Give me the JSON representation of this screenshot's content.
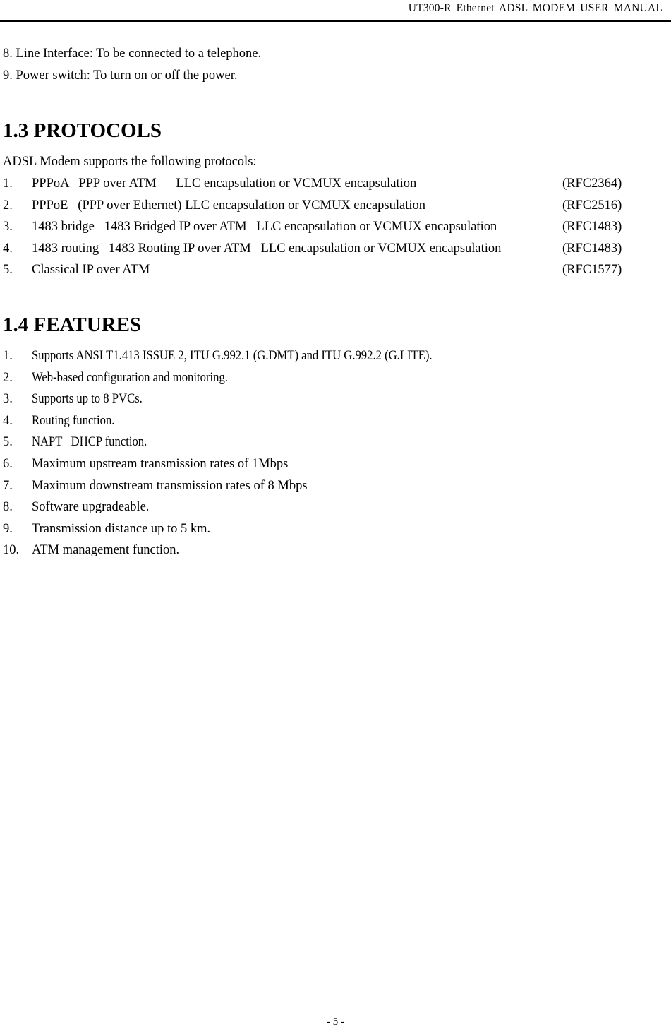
{
  "header": {
    "title": "UT300-R  Ethernet  ADSL  MODEM  USER  MANUAL"
  },
  "intro_items": [
    "8. Line Interface: To be connected to a telephone.",
    "9. Power switch: To turn on or off the power."
  ],
  "protocols": {
    "heading": "1.3 PROTOCOLS",
    "intro": "ADSL Modem supports the following protocols:",
    "items": [
      {
        "num": "1.",
        "text": "PPPoA   PPP over ATM      LLC encapsulation or VCMUX encapsulation",
        "rfc": "(RFC2364)"
      },
      {
        "num": "2.",
        "text": "PPPoE   (PPP over Ethernet) LLC encapsulation or VCMUX encapsulation",
        "rfc": "(RFC2516)"
      },
      {
        "num": "3.",
        "text": "1483 bridge   1483 Bridged IP over ATM   LLC encapsulation or VCMUX encapsulation",
        "rfc": "(RFC1483)"
      },
      {
        "num": "4.",
        "text": "1483 routing   1483 Routing IP over ATM   LLC encapsulation or VCMUX encapsulation",
        "rfc": "(RFC1483)"
      },
      {
        "num": "5.",
        "text": "Classical IP over ATM",
        "rfc": "(RFC1577)"
      }
    ]
  },
  "features": {
    "heading": "1.4 FEATURES",
    "items": [
      {
        "num": "1.",
        "text": "Supports ANSI T1.413 ISSUE 2, ITU G.992.1 (G.DMT) and ITU G.992.2 (G.LITE)."
      },
      {
        "num": "2.",
        "text": "Web-based configuration and monitoring."
      },
      {
        "num": "3.",
        "text": "Supports up to 8 PVCs."
      },
      {
        "num": "4.",
        "text": "Routing function."
      },
      {
        "num": "5.",
        "text": "NAPT   DHCP function."
      },
      {
        "num": "6.",
        "text": "Maximum upstream transmission rates of 1Mbps"
      },
      {
        "num": "7.",
        "text": "Maximum downstream transmission rates of 8 Mbps"
      },
      {
        "num": "8.",
        "text": "Software upgradeable."
      },
      {
        "num": "9.",
        "text": "Transmission distance up to 5 km."
      },
      {
        "num": "10.",
        "text": "ATM management function."
      }
    ]
  },
  "footer": {
    "page_number": "- 5 -"
  }
}
